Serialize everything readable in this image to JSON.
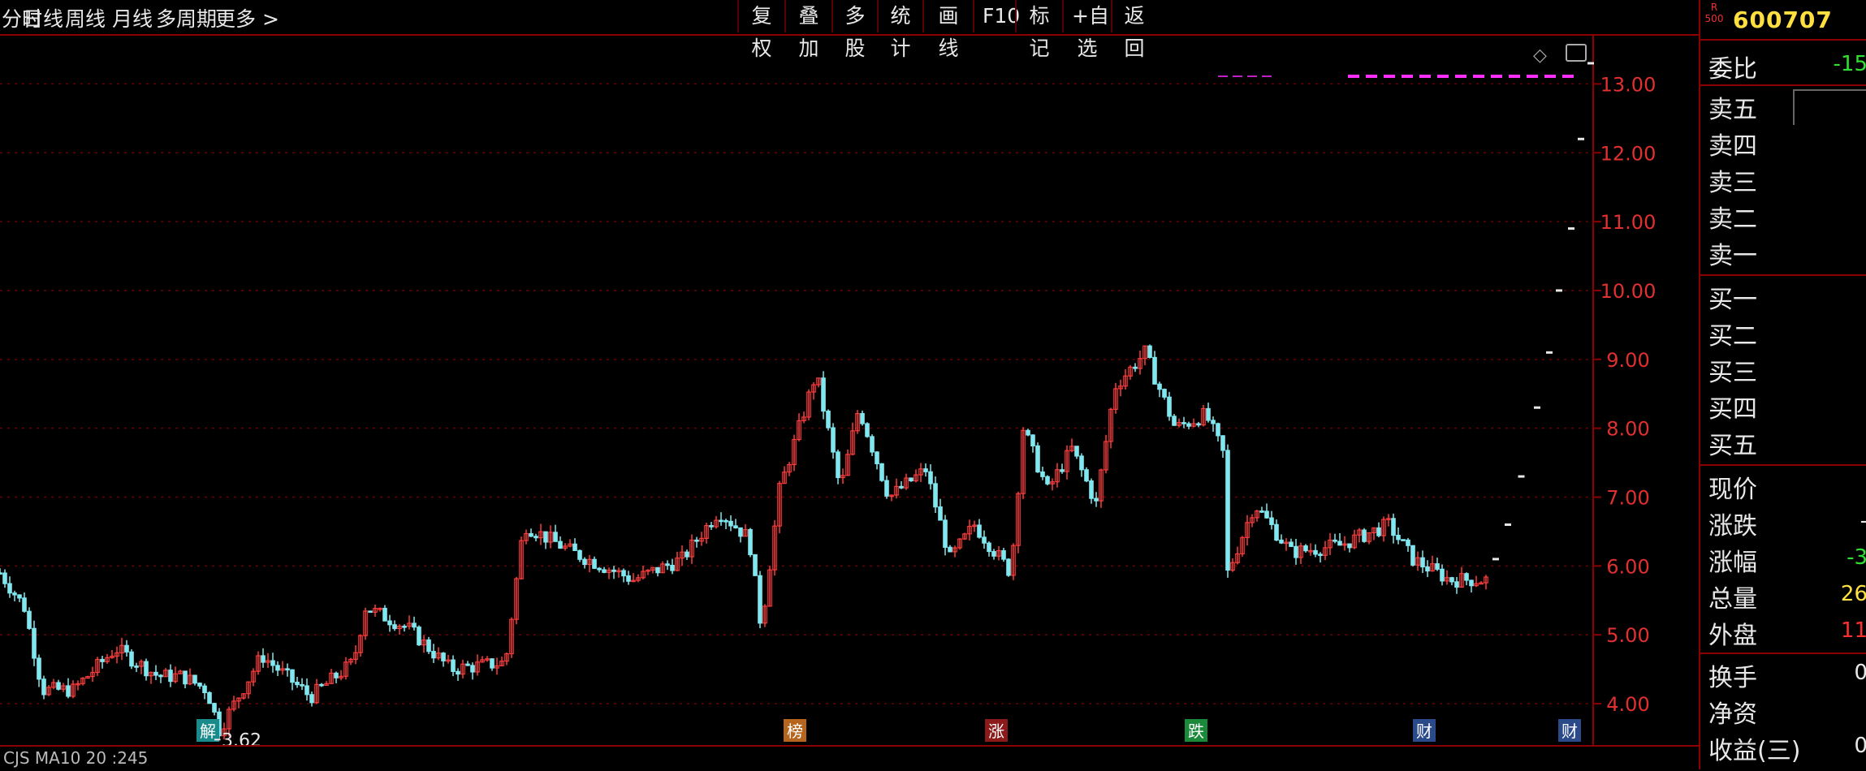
{
  "tabs": [
    "分时",
    "日线",
    "周线",
    "月线",
    "多周期",
    "更多 >"
  ],
  "toolbar": [
    "复权",
    "叠加",
    "多股",
    "统计",
    "画线",
    "F10",
    "标记",
    "+自选",
    "返回"
  ],
  "stock": {
    "badge_top": "R",
    "badge_bottom": "500",
    "code": "600707"
  },
  "right_panel": {
    "ratio_label": "委比",
    "ratio_value": "-15",
    "sell_labels": [
      "卖五",
      "卖四",
      "卖三",
      "卖二",
      "卖一"
    ],
    "buy_labels": [
      "买一",
      "买二",
      "买三",
      "买四",
      "买五"
    ],
    "stats": [
      {
        "label": "现价",
        "value": ""
      },
      {
        "label": "涨跌",
        "value": "-"
      },
      {
        "label": "涨幅",
        "value": "-3"
      },
      {
        "label": "总量",
        "value": "26"
      },
      {
        "label": "外盘",
        "value": "11"
      }
    ],
    "stats2": [
      {
        "label": "换手",
        "value": "0"
      },
      {
        "label": "净资",
        "value": ""
      },
      {
        "label": "收益(三)",
        "value": "0"
      }
    ]
  },
  "chart_data": {
    "type": "candlestick",
    "y_ticks": [
      "13.00",
      "12.00",
      "11.00",
      "10.00",
      "9.00",
      "8.00",
      "7.00",
      "6.00",
      "5.00",
      "4.00"
    ],
    "ylim": [
      3.4,
      13.7
    ],
    "min_label": "3.62",
    "markers": [
      {
        "label": "解",
        "color": "#1b8a8a"
      },
      {
        "label": "榜",
        "color": "#b5651d"
      },
      {
        "label": "涨",
        "color": "#8b1a1a"
      },
      {
        "label": "跌",
        "color": "#1a8a3a"
      },
      {
        "label": "财",
        "color": "#2a4a8a"
      },
      {
        "label": "财",
        "color": "#2a4a8a"
      }
    ],
    "anchors": [
      [
        0,
        5.9
      ],
      [
        20,
        5.4
      ],
      [
        35,
        4.2
      ],
      [
        60,
        4.2
      ],
      [
        95,
        4.8
      ],
      [
        130,
        4.4
      ],
      [
        150,
        4.4
      ],
      [
        170,
        4.2
      ],
      [
        180,
        3.62
      ],
      [
        215,
        4.7
      ],
      [
        255,
        4.1
      ],
      [
        290,
        4.6
      ],
      [
        300,
        5.4
      ],
      [
        335,
        5.1
      ],
      [
        370,
        4.5
      ],
      [
        415,
        4.6
      ],
      [
        430,
        6.6
      ],
      [
        470,
        6.2
      ],
      [
        520,
        5.8
      ],
      [
        560,
        6.1
      ],
      [
        590,
        6.8
      ],
      [
        615,
        6.4
      ],
      [
        625,
        5.1
      ],
      [
        640,
        7.1
      ],
      [
        670,
        8.8
      ],
      [
        690,
        7.1
      ],
      [
        705,
        8.3
      ],
      [
        730,
        7.0
      ],
      [
        760,
        7.4
      ],
      [
        780,
        6.1
      ],
      [
        800,
        6.6
      ],
      [
        830,
        5.9
      ],
      [
        840,
        8.0
      ],
      [
        860,
        7.1
      ],
      [
        880,
        7.7
      ],
      [
        900,
        6.9
      ],
      [
        915,
        8.6
      ],
      [
        940,
        9.1
      ],
      [
        965,
        8.0
      ],
      [
        990,
        8.2
      ],
      [
        1005,
        7.6
      ],
      [
        1008,
        5.9
      ],
      [
        1030,
        6.9
      ],
      [
        1060,
        6.2
      ],
      [
        1100,
        6.3
      ],
      [
        1140,
        6.6
      ],
      [
        1160,
        6.1
      ],
      [
        1190,
        5.8
      ],
      [
        1220,
        5.8
      ]
    ],
    "extend_ticks": [
      [
        1228,
        6.1
      ],
      [
        1238,
        6.6
      ],
      [
        1249,
        7.3
      ],
      [
        1262,
        8.3
      ],
      [
        1272,
        9.1
      ],
      [
        1280,
        10.0
      ],
      [
        1290,
        10.9
      ],
      [
        1298,
        12.2
      ],
      [
        1306,
        13.3
      ]
    ]
  }
}
